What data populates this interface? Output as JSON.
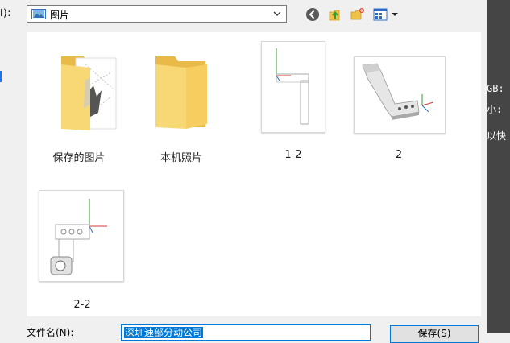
{
  "dialog": {
    "look_in_label": "I):",
    "location_value": "图片"
  },
  "toolbar": {
    "back_icon": "back-icon",
    "up_icon": "up-folder-icon",
    "new_folder_icon": "new-folder-icon",
    "view_icon": "view-menu-icon"
  },
  "files": [
    {
      "label": "保存的图片",
      "kind": "folder-with-content"
    },
    {
      "label": "本机照片",
      "kind": "folder"
    },
    {
      "label": "1-2",
      "kind": "image"
    },
    {
      "label": "2",
      "kind": "image"
    },
    {
      "label": "2-2",
      "kind": "image"
    }
  ],
  "filename": {
    "label": "文件名(N):",
    "value": "深圳速部分动公司"
  },
  "save_button": {
    "label": "保存(S)"
  },
  "background_app": {
    "line1": "GB: (",
    "line2": "小:",
    "line3": "以快"
  },
  "colors": {
    "accent": "#0078d7",
    "folder": "#f8d775"
  }
}
